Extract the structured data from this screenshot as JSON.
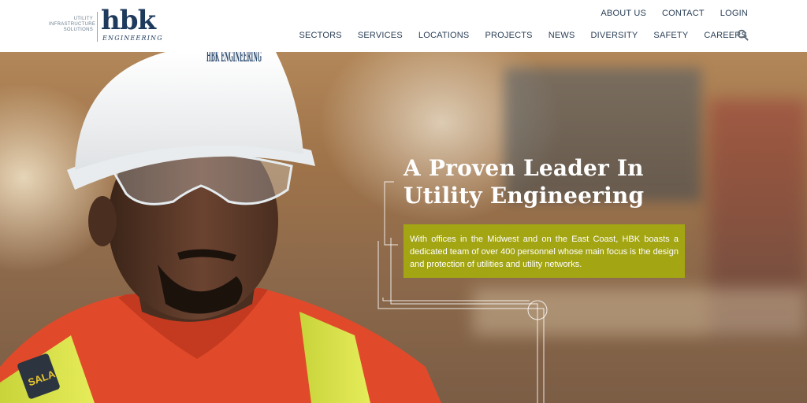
{
  "brand": {
    "tagline": [
      "UTILITY",
      "INFRASTRUCTURE",
      "SOLUTIONS"
    ],
    "logo_mark": "hbk",
    "logo_sub": "ENGINEERING"
  },
  "util_nav": {
    "about": "ABOUT US",
    "contact": "CONTACT",
    "login": "LOGIN"
  },
  "main_nav": {
    "items": [
      "SECTORS",
      "SERVICES",
      "LOCATIONS",
      "PROJECTS",
      "NEWS",
      "DIVERSITY",
      "SAFETY",
      "CAREERS"
    ],
    "search_icon": "search-icon"
  },
  "hero": {
    "headline_line1": "A Proven Leader In",
    "headline_line2": "Utility Engineering",
    "body": "With offices in the Midwest and on the East Coast, HBK boasts a dedicated team of over 400 personnel whose main focus is the design and protection of utilities and utility networks.",
    "helmet_logo": "HBK ENGINEERING",
    "vest_label": "SALA"
  },
  "colors": {
    "navy": "#1e3a5c",
    "nav_text": "#2b3f56",
    "callout_green": "#a3a513"
  }
}
